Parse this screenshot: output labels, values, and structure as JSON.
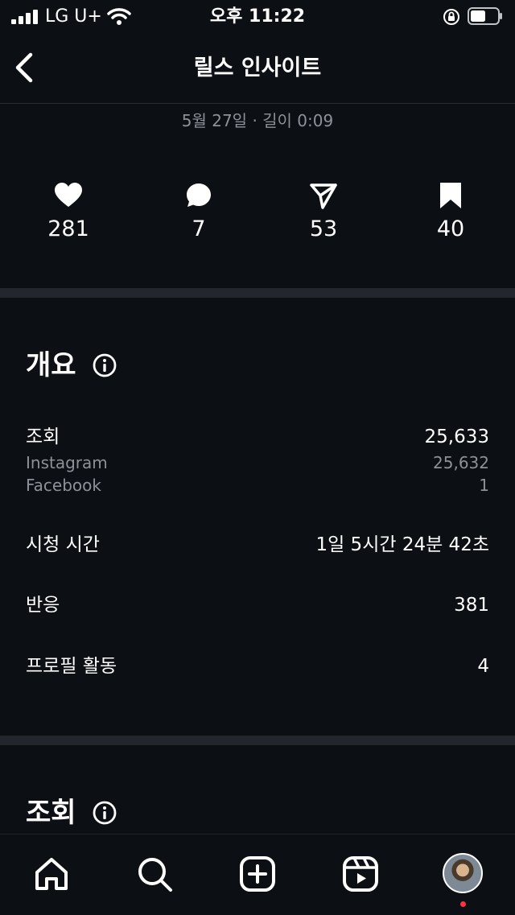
{
  "status_bar": {
    "carrier": "LG U+",
    "time": "오후 11:22"
  },
  "header": {
    "title": "릴스 인사이트",
    "subtitle": "5월 27일 · 길이 0:09"
  },
  "stats": [
    {
      "icon": "heart-icon",
      "value": "281"
    },
    {
      "icon": "comment-icon",
      "value": "7"
    },
    {
      "icon": "share-icon",
      "value": "53"
    },
    {
      "icon": "bookmark-icon",
      "value": "40"
    }
  ],
  "overview": {
    "title": "개요",
    "views_label": "조회",
    "views_value": "25,633",
    "instagram_label": "Instagram",
    "instagram_value": "25,632",
    "facebook_label": "Facebook",
    "facebook_value": "1",
    "watch_time_label": "시청 시간",
    "watch_time_value": "1일 5시간 24분 42초",
    "reactions_label": "반응",
    "reactions_value": "381",
    "profile_activity_label": "프로필 활동",
    "profile_activity_value": "4"
  },
  "views_section": {
    "title": "조회"
  },
  "tab_bar": {
    "items": [
      "home-icon",
      "search-icon",
      "create-icon",
      "reels-icon",
      "profile-avatar"
    ],
    "notification_color": "#ff3040"
  },
  "colors": {
    "background": "#0c0f14",
    "divider": "#23262c",
    "secondary_text": "#8e9198"
  }
}
